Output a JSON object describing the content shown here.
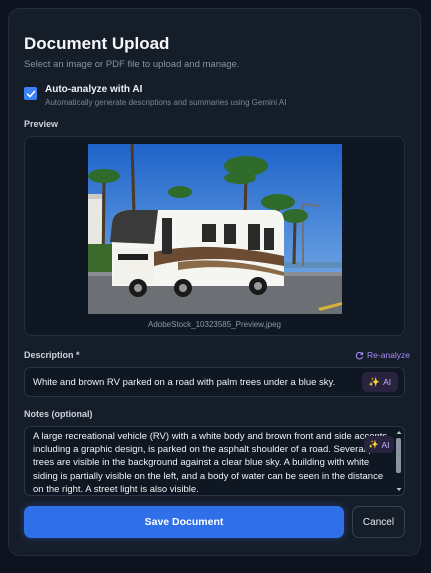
{
  "header": {
    "title": "Document Upload",
    "subtitle": "Select an image or PDF file to upload and manage."
  },
  "auto_analyze": {
    "checked": true,
    "label": "Auto-analyze with AI",
    "description": "Automatically generate descriptions and summaries using Gemini AI"
  },
  "preview": {
    "label": "Preview",
    "filename": "AdobeStock_10323585_Preview.jpeg"
  },
  "description": {
    "label": "Description *",
    "reanalyze_label": "Re-analyze",
    "value": "White and brown RV parked on a road with palm trees under a blue sky.",
    "ai_label": "AI"
  },
  "notes": {
    "label": "Notes (optional)",
    "value": "A large recreational vehicle (RV) with a white body and brown front and side accents, including a graphic design, is parked on the asphalt shoulder of a road. Several palm trees are visible in the background against a clear blue sky. A building with white siding is partially visible on the left, and a body of water can be seen in the distance on the right. A street light is also visible.",
    "ai_label": "AI"
  },
  "actions": {
    "save_label": "Save Document",
    "cancel_label": "Cancel"
  },
  "colors": {
    "accent": "#3b82f6",
    "ai_purple": "#a78bfa",
    "background": "#0d1420",
    "panel": "#151d29"
  }
}
